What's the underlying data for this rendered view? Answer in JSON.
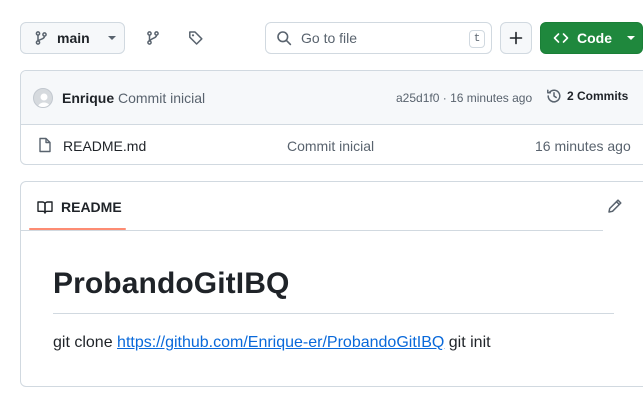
{
  "toolbar": {
    "branch_label": "main",
    "search_placeholder": "Go to file",
    "search_shortcut": "t",
    "add_label": "+",
    "code_label": "Code"
  },
  "commit": {
    "author": "Enrique",
    "message": "Commit inicial",
    "sha": "a25d1f0",
    "separator": "·",
    "time": "16 minutes ago",
    "commits_count_label": "2 Commits"
  },
  "files": [
    {
      "name": "README.md",
      "last_commit": "Commit inicial",
      "age": "16 minutes ago"
    }
  ],
  "readme": {
    "tab_label": "README",
    "title": "ProbandoGitIBQ",
    "text_before": "git clone",
    "link_text": "https://github.com/Enrique-er/ProbandoGitIBQ",
    "text_after": "git init"
  },
  "colors": {
    "code_button": "#1f883d",
    "link": "#0969da",
    "tab_underline": "#fd8c73",
    "border": "#d1d9e0",
    "muted_text": "#59636e"
  },
  "icons": [
    "git-branch-icon",
    "chevron-down-icon",
    "branches-icon",
    "tag-icon",
    "search-icon",
    "plus-icon",
    "code-icon",
    "history-icon",
    "file-icon",
    "book-icon",
    "pencil-icon"
  ]
}
